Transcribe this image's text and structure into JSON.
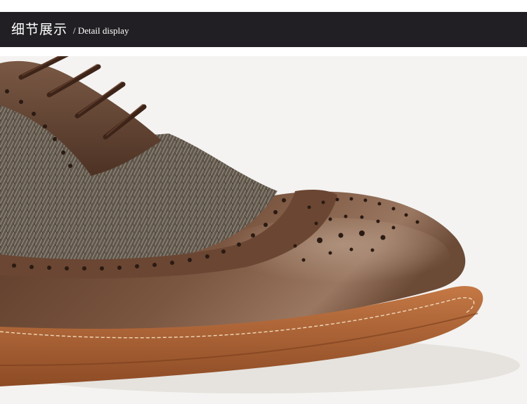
{
  "banner": {
    "title_cn": "细节展示",
    "title_en": "/ Detail display"
  },
  "photo": {
    "subject": "shoe-brogue-icon",
    "colors": {
      "background": "#f4f3f1",
      "banner": "#211f23",
      "leather": "#6e4a34",
      "sole": "#b5683b",
      "tweed": "#6a6156"
    }
  }
}
